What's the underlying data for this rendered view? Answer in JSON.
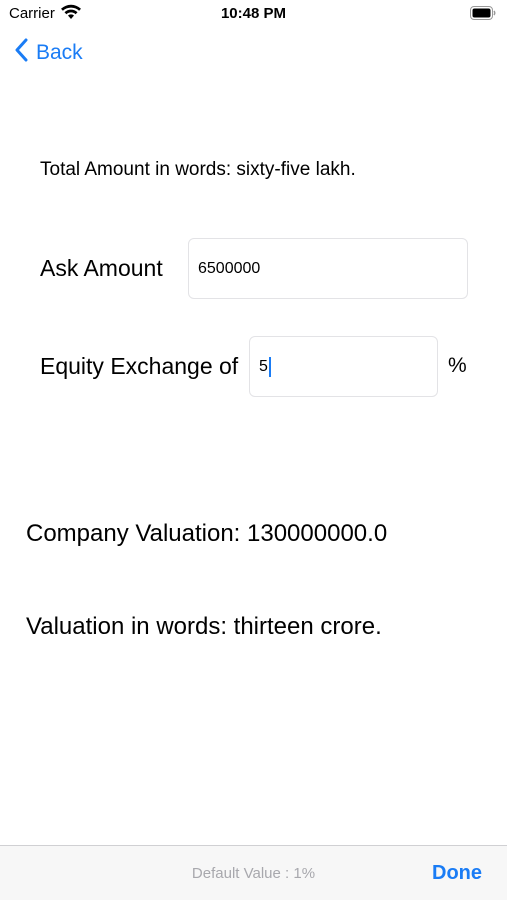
{
  "status_bar": {
    "carrier": "Carrier",
    "time": "10:48 PM",
    "wifi_icon": "wifi-icon",
    "battery_icon": "battery-icon"
  },
  "nav": {
    "back_label": "Back",
    "back_icon": "chevron-left-icon"
  },
  "total_words": "Total Amount in words: sixty-five lakh.",
  "ask_amount": {
    "label": "Ask Amount",
    "value": "6500000"
  },
  "equity": {
    "label": "Equity Exchange of",
    "value": "5",
    "suffix": "%"
  },
  "company_valuation": "Company Valuation: 130000000.0",
  "valuation_words": "Valuation in words: thirteen crore.",
  "toolbar": {
    "default_value": "Default Value : 1%",
    "done_label": "Done"
  },
  "colors": {
    "accent": "#1a7cf5",
    "toolbar_background": "#f7f7f7",
    "placeholder_gray": "#a8a8ad"
  }
}
